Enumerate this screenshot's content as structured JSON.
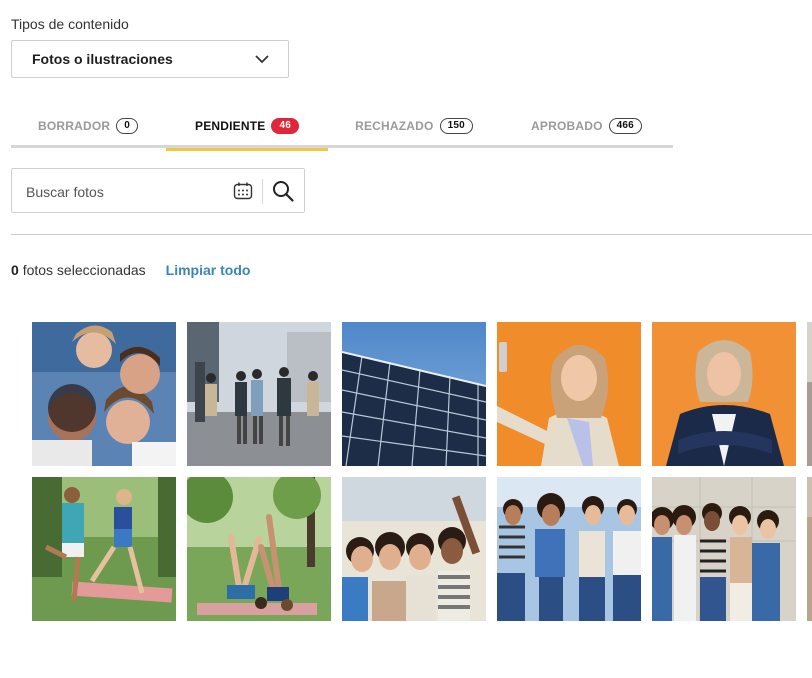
{
  "content_type": {
    "label": "Tipos de contenido",
    "selected": "Fotos o ilustraciones"
  },
  "tabs": [
    {
      "label": "BORRADOR",
      "count": "0",
      "active": false
    },
    {
      "label": "PENDIENTE",
      "count": "46",
      "active": true
    },
    {
      "label": "RECHAZADO",
      "count": "150",
      "active": false
    },
    {
      "label": "APROBADO",
      "count": "466",
      "active": false
    }
  ],
  "search": {
    "placeholder": "Buscar fotos"
  },
  "selection": {
    "count": "0",
    "text": "fotos seleccionadas",
    "clear_label": "Limpiar todo"
  },
  "colors": {
    "active_tab_underline": "#f2c744",
    "pending_badge": "#e0263b",
    "link": "#3b86b8"
  },
  "photos": [
    {
      "name": "group-lying-in-circle"
    },
    {
      "name": "women-walking-city"
    },
    {
      "name": "solar-panels"
    },
    {
      "name": "woman-selfie-orange"
    },
    {
      "name": "woman-arms-crossed-orange"
    },
    {
      "name": "partial-thumbnail"
    },
    {
      "name": "couple-stretching-park"
    },
    {
      "name": "women-yoga-park"
    },
    {
      "name": "friends-group-selfie"
    },
    {
      "name": "friends-group-standing"
    },
    {
      "name": "friends-group-wall"
    },
    {
      "name": "partial-thumbnail"
    }
  ]
}
